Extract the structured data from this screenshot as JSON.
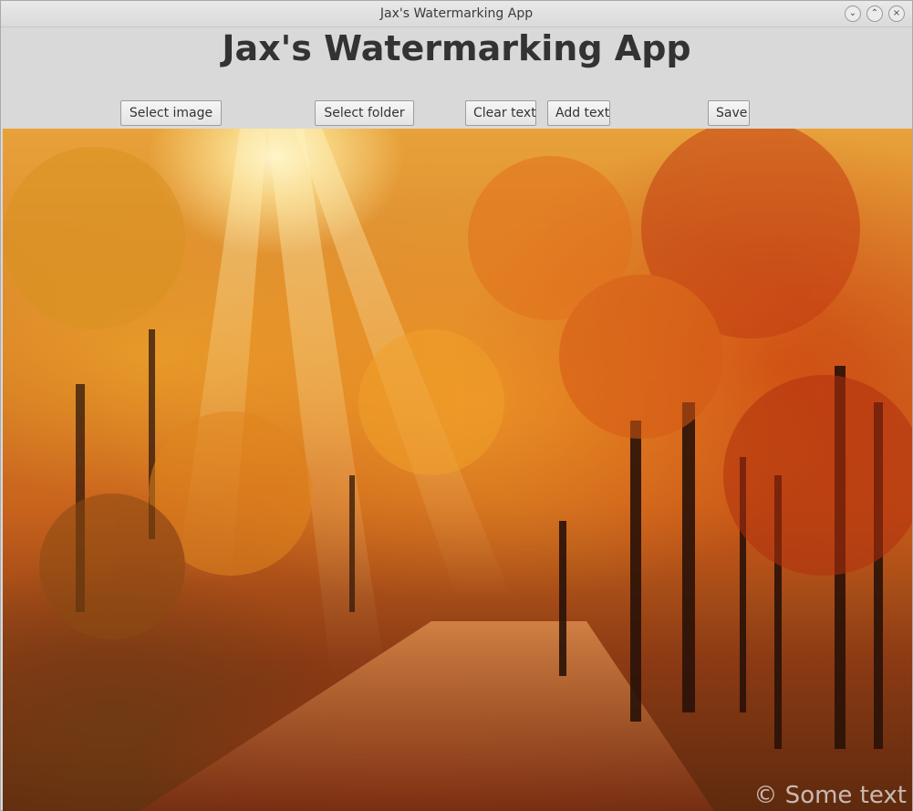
{
  "window": {
    "title": "Jax's Watermarking App",
    "controls": {
      "minimize": "⌄",
      "maximize": "⌃",
      "close": "×"
    }
  },
  "app": {
    "heading": "Jax's Watermarking App"
  },
  "toolbar": {
    "select_image_label": "Select image",
    "select_folder_label": "Select folder",
    "clear_text_label": "Clear text",
    "add_text_label": "Add text",
    "save_label": "Save"
  },
  "canvas": {
    "image_subject": "autumn forest path with sunlight",
    "watermark_text": "© Some text"
  },
  "colors": {
    "window_bg": "#d9d9d9",
    "heading": "#333333"
  }
}
